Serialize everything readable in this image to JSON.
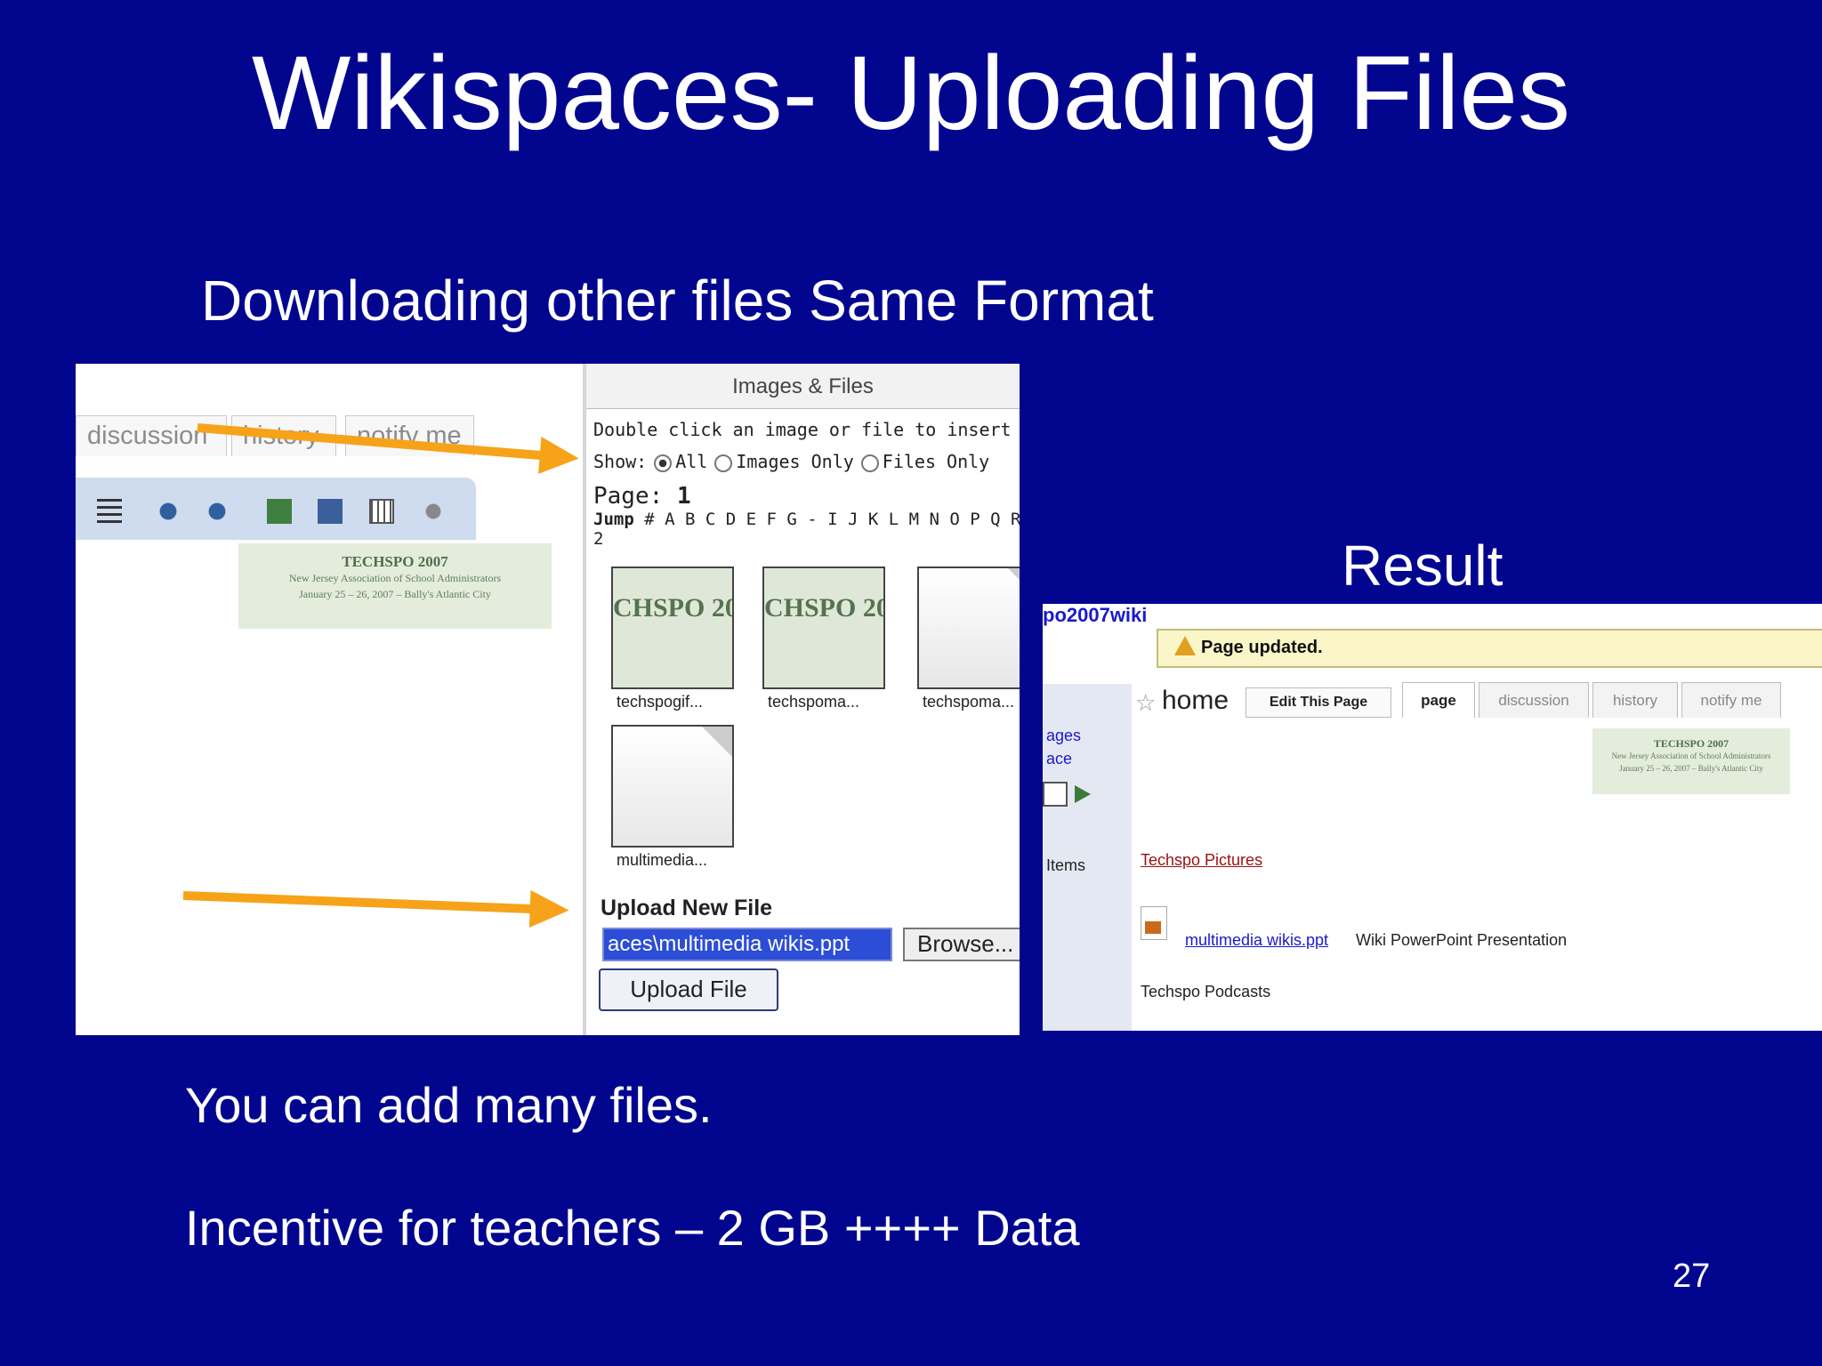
{
  "slide": {
    "title": "Wikispaces- Uploading Files",
    "subtitle": "Downloading other files Same Format",
    "result_label": "Result",
    "bullets": [
      "You can add many files.",
      "Incentive for teachers – 2 GB ++++ Data"
    ],
    "page_number": "27"
  },
  "left_screenshot": {
    "tabs": [
      "discussion",
      "history",
      "notify me"
    ],
    "banner": {
      "title": "TECHSPO 2007",
      "line1": "New Jersey Association of School Administrators",
      "line2": "January 25 – 26, 2007 – Bally's Atlantic City"
    },
    "dialog": {
      "title": "Images & Files",
      "instruction": "Double click an image or file to insert it into the",
      "show_label": "Show:",
      "show_options": [
        "All",
        "Images Only",
        "Files Only"
      ],
      "page_label": "Page:",
      "page_value": "1",
      "jump_label": "Jump",
      "jump_letters": "# A B C D E F G - I J K L M N O P Q R S T",
      "jump_extra": "2",
      "thumbnails": [
        {
          "label": "techspogif...",
          "preview": "CHSPO 20"
        },
        {
          "label": "techspoma...",
          "preview": "CHSPO 20"
        },
        {
          "label": "techspoma...",
          "preview": ""
        },
        {
          "label": "multimedia...",
          "preview": ""
        }
      ],
      "upload_heading": "Upload New File",
      "file_value": "aces\\multimedia wikis.ppt",
      "browse_label": "Browse...",
      "upload_button": "Upload File"
    }
  },
  "right_screenshot": {
    "wiki_name": "po2007wiki",
    "notice": "Page updated.",
    "home_label": "home",
    "edit_label": "Edit This Page",
    "tabs": [
      "page",
      "discussion",
      "history",
      "notify me"
    ],
    "sidebar_items": [
      "ages",
      "ace",
      "Items"
    ],
    "banner": {
      "title": "TECHSPO 2007",
      "line1": "New Jersey Association of School Administrators",
      "line2": "January 25 – 26, 2007 – Bally's Atlantic City"
    },
    "link1": "Techspo Pictures",
    "file_link": "multimedia wikis.ppt",
    "file_desc": "Wiki PowerPoint Presentation",
    "text_last": "Techspo Podcasts"
  }
}
